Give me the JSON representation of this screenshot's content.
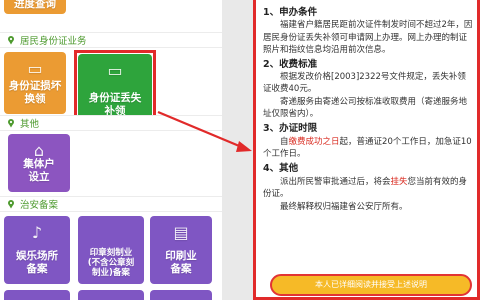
{
  "left_panel": {
    "top_tile": {
      "label": "进度查询",
      "color": "#eb9b33"
    },
    "section_resident": {
      "label": "居民身份证业务",
      "icon": "pin-icon"
    },
    "resident_tiles": [
      {
        "label": "身份证损坏\n换领",
        "color": "#eb9b33",
        "icon": "id-card-icon"
      },
      {
        "label": "身份证丢失\n补领",
        "color": "#2ea43c",
        "icon": "id-card-icon"
      }
    ],
    "section_other": {
      "label": "其他",
      "icon": "pin-icon"
    },
    "other_tiles": [
      {
        "label": "集体户\n设立",
        "color": "#8c55c0",
        "icon": "house-icon"
      }
    ],
    "section_security": {
      "label": "治安备案",
      "icon": "pin-icon"
    },
    "security_tiles": [
      {
        "label": "娱乐场所\n备案",
        "color": "#7f56c3",
        "icon": "music-icon"
      },
      {
        "label": "印章刻制业\n(不含公章刻\n制业)备案",
        "color": "#7f56c3",
        "icon": "stamp-icon"
      },
      {
        "label": "印刷业\n备案",
        "color": "#7f56c3",
        "icon": "printer-icon"
      }
    ]
  },
  "right_panel": {
    "sections": [
      {
        "heading": "1、申办条件",
        "paragraphs": [
          "福建省户籍居民距前次证件制发时间不超过2年，因居民身份证丢失补领可申请网上办理。网上办理的制证照片和指纹信息均沿用前次信息。"
        ]
      },
      {
        "heading": "2、收费标准",
        "paragraphs": [
          "根据发改价格[2003]2322号文件规定，丢失补领证收费40元。",
          "寄递服务由寄递公司按标准收取费用（寄递服务地址仅限省内）。"
        ]
      },
      {
        "heading": "3、办证时限",
        "paragraph_parts": [
          "自",
          "缴费成功之日",
          "起，普通证20个工作日，加急证10个工作日。"
        ]
      },
      {
        "heading": "4、其他",
        "paragraph_parts": [
          "派出所民警审批通过后，将会",
          "挂失",
          "您当前有效的身份证。"
        ],
        "paragraphs": [
          "最终解释权归福建省公安厅所有。"
        ]
      }
    ],
    "button_label": "本人已详细阅读并接受上述说明",
    "accent_color": "#d92a1f"
  },
  "colors": {
    "highlight": "#e12a2a",
    "button": "#f6b71c",
    "section_text": "#4d9a2e"
  }
}
